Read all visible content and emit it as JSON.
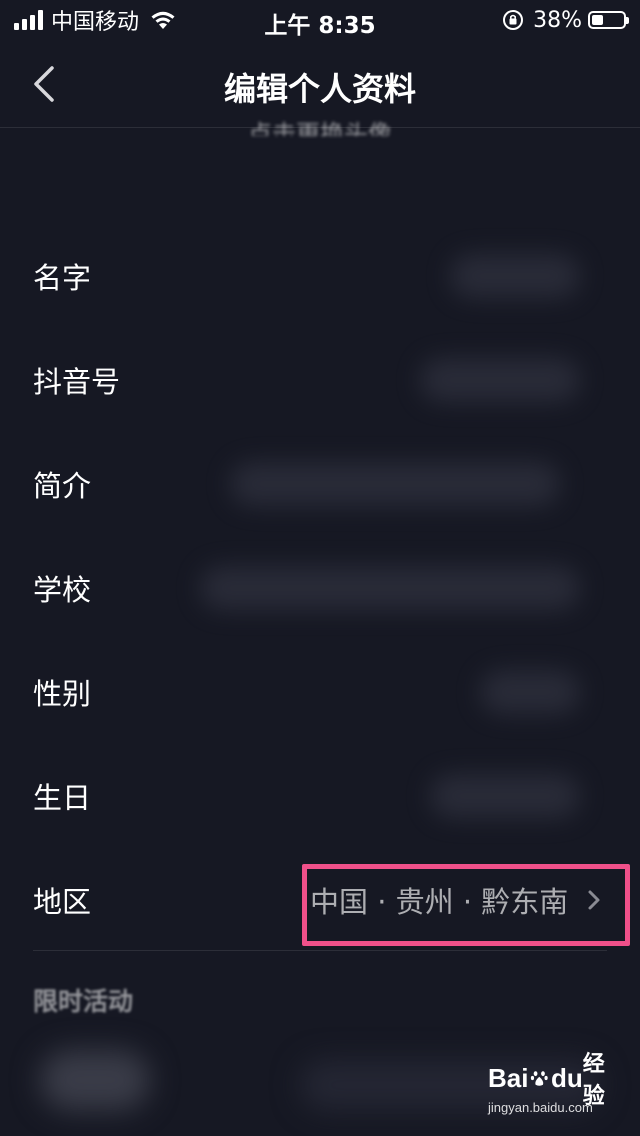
{
  "status_bar": {
    "carrier": "中国移动",
    "time": "上午 8:35",
    "battery": "38%",
    "battery_level": 0.38,
    "icons": [
      "signal-icon",
      "wifi-icon",
      "orientation-lock-icon",
      "battery-icon"
    ]
  },
  "nav": {
    "title": "编辑个人资料",
    "back_icon": "chevron-left-icon"
  },
  "avatar_hint": "点击更换头像",
  "rows": [
    {
      "label": "名字"
    },
    {
      "label": "抖音号"
    },
    {
      "label": "简介"
    },
    {
      "label": "学校"
    },
    {
      "label": "性别"
    },
    {
      "label": "生日"
    },
    {
      "label": "地区",
      "value": "中国 · 贵州 · 黔东南"
    }
  ],
  "section_title": "限时活动",
  "watermark": {
    "brand_bai": "Bai",
    "brand_du": "du",
    "brand_suffix": "经验",
    "url": "jingyan.baidu.com"
  },
  "colors": {
    "background": "#161823",
    "highlight": "#f0508a"
  }
}
